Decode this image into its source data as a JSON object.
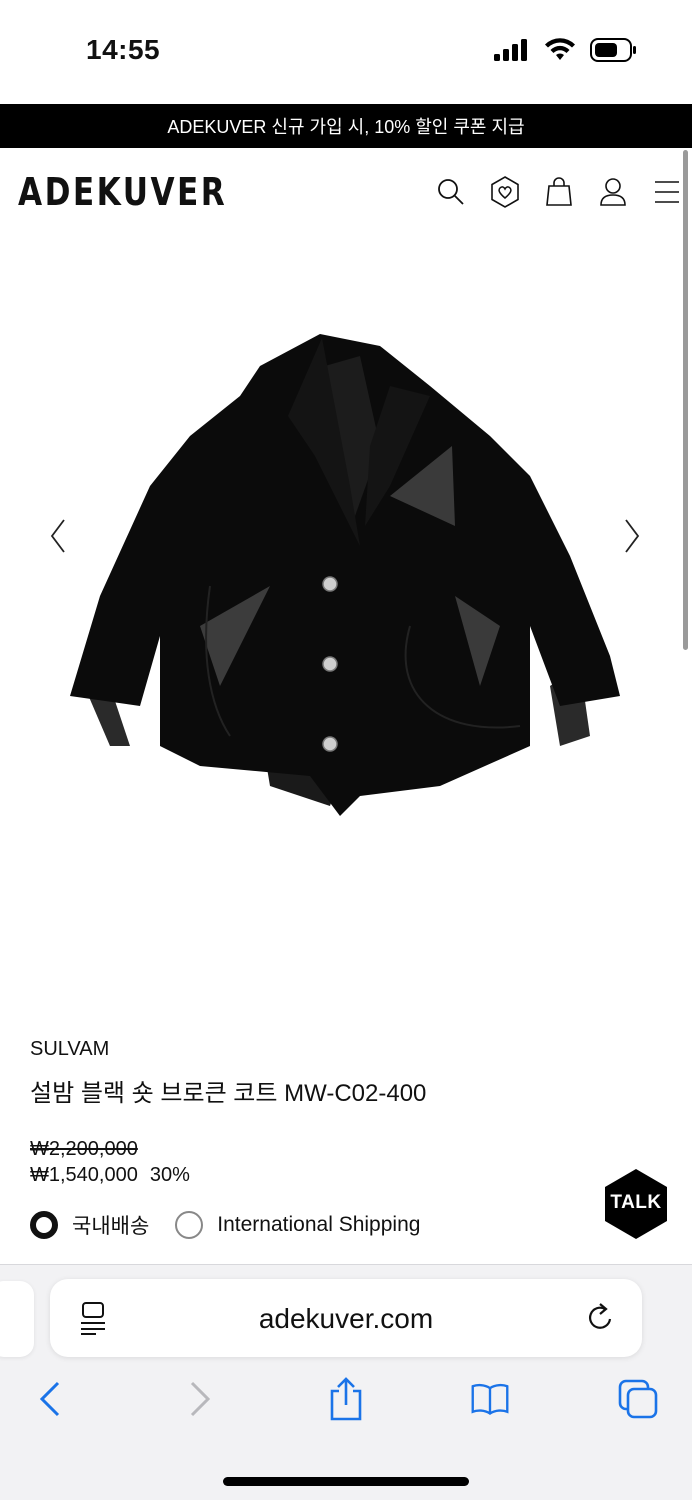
{
  "status_bar": {
    "time": "14:55"
  },
  "promo": {
    "text": "ADEKUVER 신규 가입 시, 10% 할인 쿠폰 지급"
  },
  "header": {
    "logo": "ADEKUVER",
    "icons": [
      "search-icon",
      "wishlist-heart-icon",
      "shopping-bag-icon",
      "user-icon",
      "menu-icon"
    ]
  },
  "product": {
    "brand": "SULVAM",
    "name": "설밤 블랙 숏 브로큰 코트 MW-C02-400",
    "price_original": "₩2,200,000",
    "price_sale": "₩1,540,000",
    "discount": "30%"
  },
  "shipping": {
    "options": [
      {
        "label": "국내배송",
        "selected": true
      },
      {
        "label": "International Shipping",
        "selected": false
      }
    ]
  },
  "talk": {
    "label": "TALK"
  },
  "browser": {
    "url": "adekuver.com",
    "accent": "#1a73e8"
  }
}
